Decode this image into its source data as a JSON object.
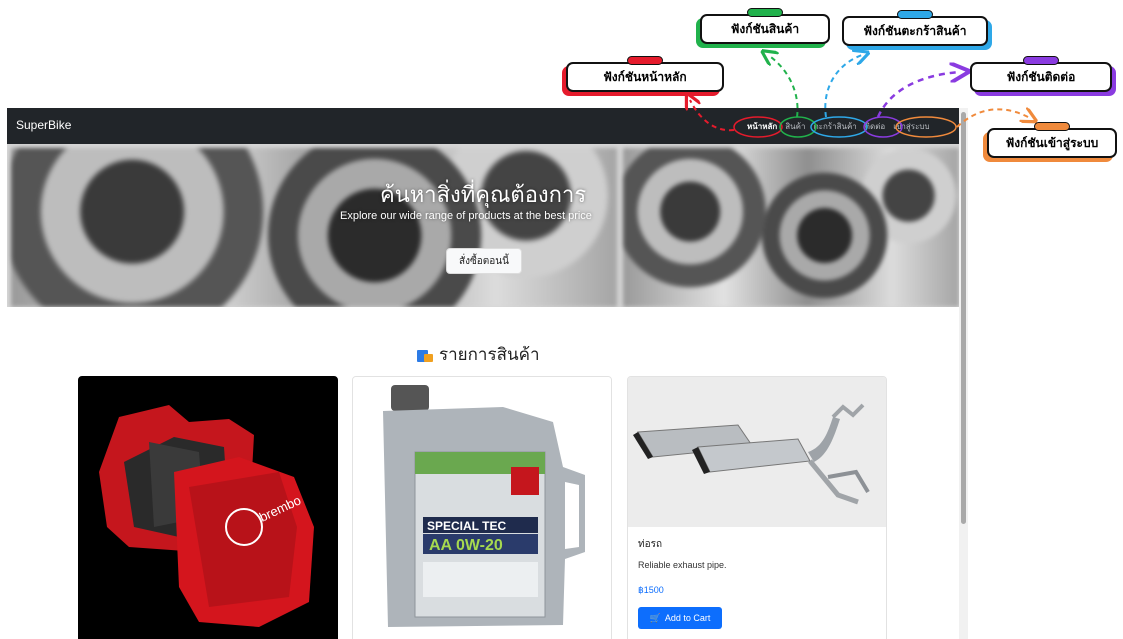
{
  "site": {
    "brand": "SuperBike",
    "nav": [
      "หน้าหลัก",
      "สินค้า",
      "ตะกร้าสินค้า",
      "ติดต่อ",
      "เข้าสู่ระบบ"
    ],
    "hero": {
      "title": "ค้นหาสิ่งที่คุณต้องการ",
      "subtitle": "Explore our wide range of products at the best price",
      "button": "สั่งซื้อตอนนี้"
    },
    "section_title": "รายการสินค้า",
    "products": [
      {
        "name": "ท่อรถ",
        "description": "Reliable exhaust pipe.",
        "price": "฿1500",
        "cart_button": "Add to Cart"
      }
    ]
  },
  "annotations": {
    "home": "ฟังก์ชันหน้าหลัก",
    "products": "ฟังก์ชันสินค้า",
    "cart": "ฟังก์ชันตะกร้าสินค้า",
    "contact": "ฟังก์ชันติดต่อ",
    "login": "ฟังก์ชันเข้าสู่ระบบ"
  },
  "colors": {
    "navbar": "#212529",
    "primary": "#0d6efd",
    "home": "#e51b2c",
    "products": "#21b24c",
    "cart": "#2ea8e8",
    "contact": "#8a3be0",
    "login": "#f08a3c"
  },
  "icons": {
    "section_icon": "package-icon",
    "cart_icon": "cart-icon"
  }
}
